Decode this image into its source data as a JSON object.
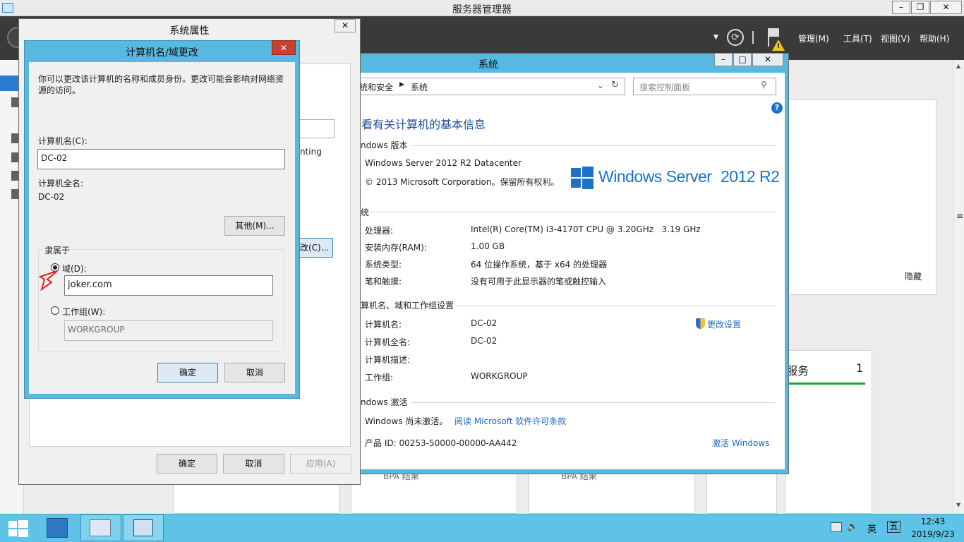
{
  "server_manager": {
    "title": "服务器管理器",
    "menu": [
      "管理(M)",
      "工具(T)",
      "视图(V)",
      "帮助(H)"
    ],
    "tile": {
      "label": "服务",
      "count": "1"
    },
    "hide_label": "隐藏",
    "bpa_label": "BPA 结果"
  },
  "sysprops": {
    "title": "系统属性",
    "ok": "确定",
    "cancel": "取消",
    "apply": "应用(A)",
    "partial_text": "nting",
    "partial_button": "改(C)..."
  },
  "rename": {
    "title": "计算机名/域更改",
    "intro": "你可以更改该计算机的名称和成员身份。更改可能会影响对网络资源的访问。",
    "computer_name_label": "计算机名(C):",
    "computer_name_value": "DC-02",
    "full_name_label": "计算机全名:",
    "full_name_value": "DC-02",
    "more_button": "其他(M)...",
    "member_of": "隶属于",
    "domain_label": "域(D):",
    "domain_value": "joker.com",
    "workgroup_label": "工作组(W):",
    "workgroup_value": "WORKGROUP",
    "ok": "确定",
    "cancel": "取消"
  },
  "system": {
    "title": "系统",
    "breadcrumb": [
      "统和安全",
      "系统"
    ],
    "search_placeholder": "搜索控制面板",
    "heading": "看有关计算机的基本信息",
    "edition_section": "ndows 版本",
    "edition": "Windows Server 2012 R2 Datacenter",
    "copyright": "© 2013 Microsoft Corporation。保留所有权利。",
    "logo_text": "Windows Server",
    "logo_version": "2012 R2",
    "system_section": "统",
    "rows": [
      {
        "label": "处理器:",
        "value": "Intel(R) Core(TM) i3-4170T CPU @ 3.20GHz   3.19 GHz"
      },
      {
        "label": "安装内存(RAM):",
        "value": "1.00 GB"
      },
      {
        "label": "系统类型:",
        "value": "64 位操作系统，基于 x64 的处理器"
      },
      {
        "label": "笔和触摸:",
        "value": "没有可用于此显示器的笔或触控输入"
      }
    ],
    "name_section": "算机名、域和工作组设置",
    "name_rows": [
      {
        "label": "计算机名:",
        "value": "DC-02"
      },
      {
        "label": "计算机全名:",
        "value": "DC-02"
      },
      {
        "label": "计算机描述:",
        "value": ""
      },
      {
        "label": "工作组:",
        "value": "WORKGROUP"
      }
    ],
    "change_settings": "更改设置",
    "activation_section": "ndows 激活",
    "activation_status": "Windows 尚未激活。",
    "license_link": "阅读 Microsoft 软件许可条款",
    "product_id": "产品 ID: 00253-50000-00000-AA442",
    "activate_link": "激活 Windows"
  },
  "taskbar": {
    "time": "12:43",
    "date": "2019/9/23",
    "ime_lang": "英",
    "ime_mode": "五"
  },
  "colors": {
    "taskbar": "#5ec3e6",
    "dialog_frame": "#57b8e0",
    "close_red": "#c9402c",
    "link": "#1b6ac9",
    "toolbar": "#3a3a3a"
  }
}
